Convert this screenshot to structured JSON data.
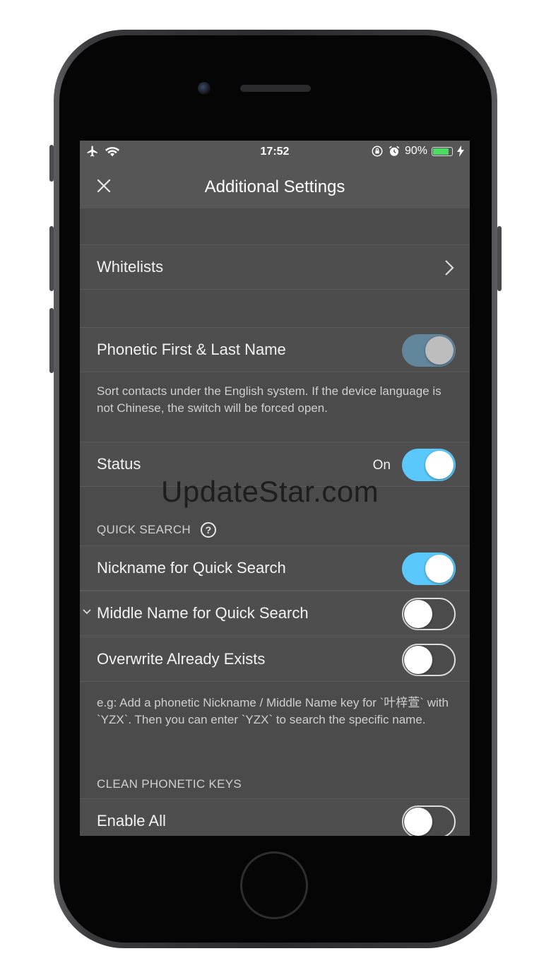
{
  "status_bar": {
    "time": "17:52",
    "battery_percent": "90%",
    "battery_level": 0.9,
    "battery_color": "#4cd964"
  },
  "nav": {
    "title": "Additional Settings",
    "close_icon": "close-icon"
  },
  "rows": {
    "whitelists": {
      "label": "Whitelists"
    },
    "phonetic": {
      "label": "Phonetic First & Last Name",
      "on": true,
      "disabled": true
    },
    "status": {
      "label": "Status",
      "value": "On",
      "on": true
    },
    "nickname": {
      "label": "Nickname for Quick Search",
      "on": true
    },
    "middle": {
      "label": "Middle Name for Quick Search",
      "on": false
    },
    "overwrite": {
      "label": "Overwrite Already  Exists",
      "on": false
    },
    "enable_all": {
      "label": "Enable All",
      "on": false
    }
  },
  "notes": {
    "phonetic": "Sort contacts under the English system. If the device language is not Chinese, the switch will be forced open.",
    "quick_search": "e.g: Add a phonetic Nickname / Middle Name key for `叶梓萱` with `YZX`. Then you can enter `YZX` to search the specific name."
  },
  "sections": {
    "quick_search": "QUICK SEARCH",
    "quick_search_help": "?",
    "clean_phonetic": "CLEAN PHONETIC KEYS"
  },
  "watermark": "UpdateStar.com",
  "colors": {
    "accent": "#5ac8fa",
    "background": "#4b4b4b"
  }
}
